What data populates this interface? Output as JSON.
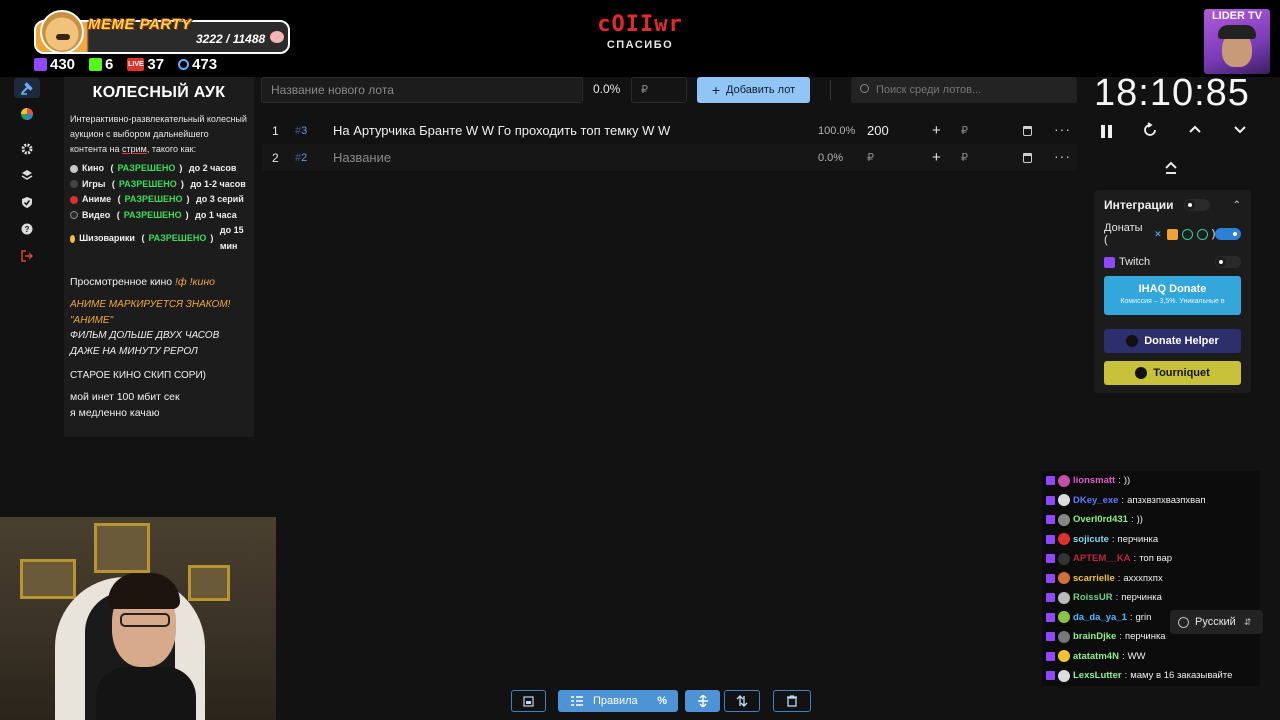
{
  "overlay": {
    "meme_title": "MEME PARTY",
    "meme_progress": "3222 / 11488",
    "stats": [
      {
        "icon": "twitch-icon",
        "value": "430"
      },
      {
        "icon": "kick-icon",
        "value": "6"
      },
      {
        "icon": "live-icon",
        "value": "37",
        "badge": "LIVE"
      },
      {
        "icon": "viewer-icon",
        "value": "473"
      }
    ],
    "streamer_name": "cOIIwr",
    "streamer_sub": "СПАСИБО",
    "lider_label": "LIDER TV"
  },
  "sidebar": {
    "icons": [
      "gavel-icon",
      "wheel-icon",
      "gear-icon",
      "layers-icon",
      "shield-icon",
      "help-icon",
      "logout-icon"
    ]
  },
  "description": {
    "title": "КОЛЕСНЫЙ АУК",
    "intro_a": "Интерактивно-развлекательный колесный аукцион с выбором дальнейшего контента на ",
    "intro_link": "стрим",
    "intro_b": ", такого как:",
    "rules": [
      {
        "name": "Кино",
        "status": "РАЗРЕШЕНО",
        "limit": "до 2 часов",
        "color": "#c8c8c8"
      },
      {
        "name": "Игры",
        "status": "РАЗРЕШЕНО",
        "limit": "до 1-2 часов",
        "color": "#444444"
      },
      {
        "name": "Аниме",
        "status": "РАЗРЕШЕНО",
        "limit": "до 3 серий",
        "color": "#e03030"
      },
      {
        "name": "Видео",
        "status": "РАЗРЕШЕНО",
        "limit": "до 1 часа",
        "color": "#2a2a2a"
      },
      {
        "name": "Шизоварики",
        "status": "РАЗРЕШЕНО",
        "limit": "до 15 мин",
        "color": "#f2c230"
      }
    ],
    "watched_label": "Просмотренное кино",
    "watched_cmd": "!ф !кино",
    "anime_note": "АНИМЕ МАРКИРУЕТСЯ ЗНАКОМ!",
    "anime_mark": "\"АНИМЕ\"",
    "film_note_1": "ФИЛЬМ ДОЛЬШЕ ДВУХ ЧАСОВ",
    "film_note_2": "ДАЖЕ НА МИНУТУ РЕРОЛ",
    "old_cinema": "СТАРОЕ КИНО СКИП СОРИ)",
    "net_1": "мой инет 100 мбит сек",
    "net_2": "я медленно качаю"
  },
  "lot_form": {
    "name_placeholder": "Название нового лота",
    "percent": "0.0%",
    "amount_placeholder": "₽",
    "add_button": "Добавить лот",
    "search_placeholder": "Поиск среди лотов..."
  },
  "lots": [
    {
      "index": "1",
      "id": "3",
      "title": "На Артурчика Бранте W W Го проходить топ темку W W",
      "percent": "100.0%",
      "amount": "200",
      "currency": "₽"
    },
    {
      "index": "2",
      "id": "2",
      "title": "Название",
      "percent": "0.0%",
      "amount": "₽",
      "currency": "₽"
    }
  ],
  "timer": {
    "time": "18:10:85"
  },
  "integrations": {
    "title": "Интеграции",
    "donations_label": "Донаты (",
    "donations_close": ")",
    "twitch_label": "Twitch",
    "donations_on": true,
    "twitch_on": false,
    "master_on": false,
    "da_title": "IHAQ Donate",
    "da_sub": "Комиссия – 3,5%. Уникальные в",
    "dh_label": "Donate Helper",
    "tq_label": "Tourniquet"
  },
  "chat": [
    {
      "user": "lionsmatt",
      "msg": "))",
      "color": "#e05cc9"
    },
    {
      "user": "DKey_exe",
      "msg": "апзхвзпхвазпхвап",
      "color": "#5a7cff"
    },
    {
      "user": "Overl0rd431",
      "msg": "))",
      "color": "#8cf08c"
    },
    {
      "user": "sojicute",
      "msg": "перчинка",
      "color": "#7fd7f0"
    },
    {
      "user": "APTEM__KA",
      "msg": "топ вар",
      "color": "#c0283a"
    },
    {
      "user": "scarrielle",
      "msg": "ахххпхпх",
      "color": "#f2c230"
    },
    {
      "user": "RoissUR",
      "msg": "перчинка",
      "color": "#6bd18a"
    },
    {
      "user": "da_da_ya_1",
      "msg": "grin",
      "color": "#4fb8ff"
    },
    {
      "user": "brainDjke",
      "msg": "перчинка",
      "color": "#8cf08c"
    },
    {
      "user": "atatatm4N",
      "msg": "WW",
      "color": "#8cf08c"
    },
    {
      "user": "LexsLutter",
      "msg": "маму в 16 заказывайте",
      "color": "#8cf08c"
    }
  ],
  "language": {
    "current": "Русский"
  },
  "toolbar": {
    "rules_label": "Правила"
  }
}
